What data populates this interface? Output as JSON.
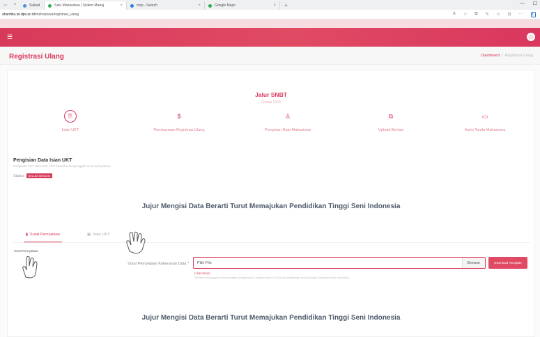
{
  "browser": {
    "tabs": [
      {
        "title": "Siakad Institut",
        "active": false
      },
      {
        "title": "Satu Mahasiswa | Sistem Manaj",
        "active": true
      },
      {
        "title": "map - Search",
        "active": false
      },
      {
        "title": "Google Maps",
        "active": false
      }
    ],
    "url_domain": "ahardika.isi-dps.ac.id",
    "url_path": "/mahasiswa/registrasi_ulang"
  },
  "page": {
    "title": "Registrasi Ulang",
    "breadcrumb": {
      "home": "Dashboard",
      "current": "Registrasi Ulang"
    }
  },
  "jalur": {
    "title": "Jalur SNBT",
    "subtitle": "Genap 2023"
  },
  "steps": [
    {
      "label": "Isian UKT",
      "icon": "circle-doc-icon"
    },
    {
      "label": "Pembayaran Registrasi Ulang",
      "icon": "dollar-icon"
    },
    {
      "label": "Pengisian Data Mahasiswa",
      "icon": "user-icon"
    },
    {
      "label": "Upload Berkas",
      "icon": "file-copy-icon"
    },
    {
      "label": "Kartu Tanda Mahasiswa",
      "icon": "card-icon"
    }
  ],
  "section": {
    "title": "Pengisian Data Isian UKT",
    "subtitle": "Pengisian form data isian UKT beserta mengunggah surat pernyataan",
    "status_label": "Status",
    "status_badge": "BELUM MENGISI"
  },
  "motto": "Jujur Mengisi Data Berarti Turut Memajukan Pendidikan Tinggi Seni Indonesia",
  "tabs": [
    {
      "label": "Surat Pernyataan",
      "active": true
    },
    {
      "label": "Isian UKT",
      "active": false
    }
  ],
  "form": {
    "section_label": "Surat Pernyataan",
    "field_label": "Surat Pernyataan Kebenaran Data",
    "required_mark": "*",
    "file_placeholder": "Pilih File",
    "browse_label": "Browse",
    "download_label": "Download Template",
    "view_link": "Lihat Surat",
    "hint": "Silahkan mengunggah surat pernyataan dengan benar. Lengkapi materai 10.000 dan tandatangan sesuai dengan format yang telah disediakan."
  },
  "colors": {
    "accent": "#d8395a",
    "heading_text": "#4d5a6b"
  }
}
